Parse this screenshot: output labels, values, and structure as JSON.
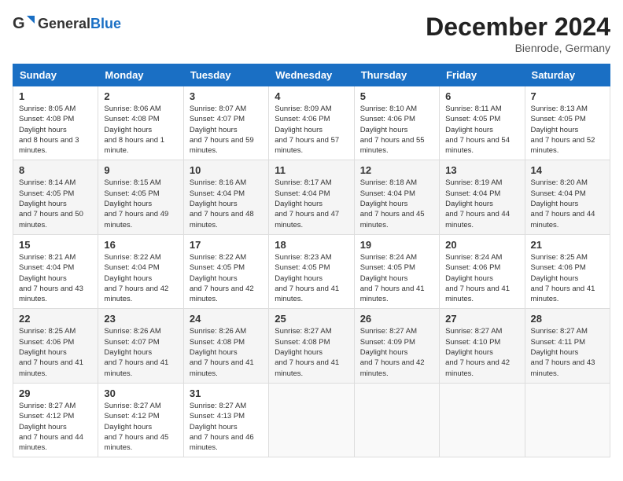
{
  "header": {
    "logo_general": "General",
    "logo_blue": "Blue",
    "title": "December 2024",
    "location": "Bienrode, Germany"
  },
  "columns": [
    "Sunday",
    "Monday",
    "Tuesday",
    "Wednesday",
    "Thursday",
    "Friday",
    "Saturday"
  ],
  "weeks": [
    [
      {
        "day": "1",
        "sunrise": "8:05 AM",
        "sunset": "4:08 PM",
        "daylight": "8 hours and 3 minutes."
      },
      {
        "day": "2",
        "sunrise": "8:06 AM",
        "sunset": "4:08 PM",
        "daylight": "8 hours and 1 minute."
      },
      {
        "day": "3",
        "sunrise": "8:07 AM",
        "sunset": "4:07 PM",
        "daylight": "7 hours and 59 minutes."
      },
      {
        "day": "4",
        "sunrise": "8:09 AM",
        "sunset": "4:06 PM",
        "daylight": "7 hours and 57 minutes."
      },
      {
        "day": "5",
        "sunrise": "8:10 AM",
        "sunset": "4:06 PM",
        "daylight": "7 hours and 55 minutes."
      },
      {
        "day": "6",
        "sunrise": "8:11 AM",
        "sunset": "4:05 PM",
        "daylight": "7 hours and 54 minutes."
      },
      {
        "day": "7",
        "sunrise": "8:13 AM",
        "sunset": "4:05 PM",
        "daylight": "7 hours and 52 minutes."
      }
    ],
    [
      {
        "day": "8",
        "sunrise": "8:14 AM",
        "sunset": "4:05 PM",
        "daylight": "7 hours and 50 minutes."
      },
      {
        "day": "9",
        "sunrise": "8:15 AM",
        "sunset": "4:05 PM",
        "daylight": "7 hours and 49 minutes."
      },
      {
        "day": "10",
        "sunrise": "8:16 AM",
        "sunset": "4:04 PM",
        "daylight": "7 hours and 48 minutes."
      },
      {
        "day": "11",
        "sunrise": "8:17 AM",
        "sunset": "4:04 PM",
        "daylight": "7 hours and 47 minutes."
      },
      {
        "day": "12",
        "sunrise": "8:18 AM",
        "sunset": "4:04 PM",
        "daylight": "7 hours and 45 minutes."
      },
      {
        "day": "13",
        "sunrise": "8:19 AM",
        "sunset": "4:04 PM",
        "daylight": "7 hours and 44 minutes."
      },
      {
        "day": "14",
        "sunrise": "8:20 AM",
        "sunset": "4:04 PM",
        "daylight": "7 hours and 44 minutes."
      }
    ],
    [
      {
        "day": "15",
        "sunrise": "8:21 AM",
        "sunset": "4:04 PM",
        "daylight": "7 hours and 43 minutes."
      },
      {
        "day": "16",
        "sunrise": "8:22 AM",
        "sunset": "4:04 PM",
        "daylight": "7 hours and 42 minutes."
      },
      {
        "day": "17",
        "sunrise": "8:22 AM",
        "sunset": "4:05 PM",
        "daylight": "7 hours and 42 minutes."
      },
      {
        "day": "18",
        "sunrise": "8:23 AM",
        "sunset": "4:05 PM",
        "daylight": "7 hours and 41 minutes."
      },
      {
        "day": "19",
        "sunrise": "8:24 AM",
        "sunset": "4:05 PM",
        "daylight": "7 hours and 41 minutes."
      },
      {
        "day": "20",
        "sunrise": "8:24 AM",
        "sunset": "4:06 PM",
        "daylight": "7 hours and 41 minutes."
      },
      {
        "day": "21",
        "sunrise": "8:25 AM",
        "sunset": "4:06 PM",
        "daylight": "7 hours and 41 minutes."
      }
    ],
    [
      {
        "day": "22",
        "sunrise": "8:25 AM",
        "sunset": "4:06 PM",
        "daylight": "7 hours and 41 minutes."
      },
      {
        "day": "23",
        "sunrise": "8:26 AM",
        "sunset": "4:07 PM",
        "daylight": "7 hours and 41 minutes."
      },
      {
        "day": "24",
        "sunrise": "8:26 AM",
        "sunset": "4:08 PM",
        "daylight": "7 hours and 41 minutes."
      },
      {
        "day": "25",
        "sunrise": "8:27 AM",
        "sunset": "4:08 PM",
        "daylight": "7 hours and 41 minutes."
      },
      {
        "day": "26",
        "sunrise": "8:27 AM",
        "sunset": "4:09 PM",
        "daylight": "7 hours and 42 minutes."
      },
      {
        "day": "27",
        "sunrise": "8:27 AM",
        "sunset": "4:10 PM",
        "daylight": "7 hours and 42 minutes."
      },
      {
        "day": "28",
        "sunrise": "8:27 AM",
        "sunset": "4:11 PM",
        "daylight": "7 hours and 43 minutes."
      }
    ],
    [
      {
        "day": "29",
        "sunrise": "8:27 AM",
        "sunset": "4:12 PM",
        "daylight": "7 hours and 44 minutes."
      },
      {
        "day": "30",
        "sunrise": "8:27 AM",
        "sunset": "4:12 PM",
        "daylight": "7 hours and 45 minutes."
      },
      {
        "day": "31",
        "sunrise": "8:27 AM",
        "sunset": "4:13 PM",
        "daylight": "7 hours and 46 minutes."
      },
      null,
      null,
      null,
      null
    ]
  ]
}
